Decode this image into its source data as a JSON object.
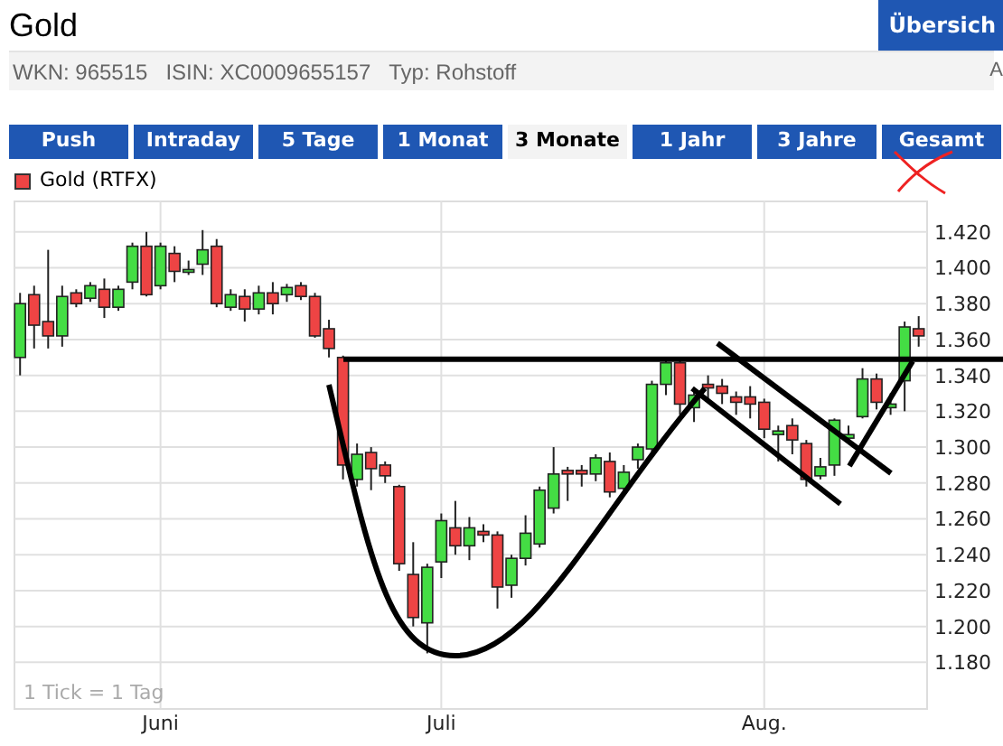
{
  "header": {
    "title": "Gold",
    "button": "Übersich"
  },
  "info_bar": {
    "items": [
      "WKN: 965515",
      "ISIN: XC0009655157",
      "Typ: Rohstoff"
    ],
    "right_text": "A"
  },
  "tabs": [
    {
      "label": "Push",
      "selected": false
    },
    {
      "label": "Intraday",
      "selected": false
    },
    {
      "label": "5 Tage",
      "selected": false
    },
    {
      "label": "1 Monat",
      "selected": false
    },
    {
      "label": "3 Monate",
      "selected": true
    },
    {
      "label": "1 Jahr",
      "selected": false
    },
    {
      "label": "3 Jahre",
      "selected": false
    },
    {
      "label": "Gesamt",
      "selected": false
    }
  ],
  "legend": {
    "label": "Gold (RTFX)"
  },
  "chart": {
    "note": "1 Tick = 1 Tag",
    "chart_data": {
      "type": "candlestick",
      "categories": [
        null,
        null,
        null,
        null,
        null,
        null,
        null,
        null,
        null,
        null,
        "Juni",
        null,
        null,
        null,
        null,
        null,
        null,
        null,
        null,
        null,
        null,
        null,
        null,
        null,
        null,
        null,
        null,
        null,
        null,
        null,
        "Juli",
        null,
        null,
        null,
        null,
        null,
        null,
        null,
        null,
        null,
        null,
        null,
        null,
        null,
        null,
        null,
        null,
        null,
        null,
        null,
        null,
        null,
        null,
        "Aug.",
        null,
        null,
        null,
        null,
        null,
        null,
        null,
        null,
        null,
        null,
        null
      ],
      "ohlc": [
        [
          1.35,
          1.386,
          1.34,
          1.38
        ],
        [
          1.385,
          1.39,
          1.355,
          1.368
        ],
        [
          1.37,
          1.41,
          1.355,
          1.362
        ],
        [
          1.362,
          1.39,
          1.356,
          1.384
        ],
        [
          1.386,
          1.388,
          1.378,
          1.38
        ],
        [
          1.383,
          1.392,
          1.381,
          1.39
        ],
        [
          1.388,
          1.394,
          1.372,
          1.378
        ],
        [
          1.378,
          1.39,
          1.376,
          1.388
        ],
        [
          1.392,
          1.414,
          1.388,
          1.412
        ],
        [
          1.412,
          1.42,
          1.384,
          1.385
        ],
        [
          1.39,
          1.414,
          1.388,
          1.412
        ],
        [
          1.408,
          1.412,
          1.392,
          1.398
        ],
        [
          1.398,
          1.404,
          1.396,
          1.399
        ],
        [
          1.402,
          1.421,
          1.396,
          1.41
        ],
        [
          1.412,
          1.416,
          1.378,
          1.38
        ],
        [
          1.378,
          1.388,
          1.376,
          1.385
        ],
        [
          1.384,
          1.388,
          1.37,
          1.377
        ],
        [
          1.377,
          1.39,
          1.374,
          1.386
        ],
        [
          1.386,
          1.392,
          1.374,
          1.38
        ],
        [
          1.385,
          1.391,
          1.381,
          1.389
        ],
        [
          1.39,
          1.392,
          1.382,
          1.384
        ],
        [
          1.384,
          1.386,
          1.361,
          1.362
        ],
        [
          1.366,
          1.371,
          1.35,
          1.355
        ],
        [
          1.35,
          1.351,
          1.282,
          1.29
        ],
        [
          1.282,
          1.302,
          1.278,
          1.296
        ],
        [
          1.297,
          1.3,
          1.276,
          1.288
        ],
        [
          1.29,
          1.292,
          1.28,
          1.284
        ],
        [
          1.278,
          1.279,
          1.231,
          1.235
        ],
        [
          1.229,
          1.247,
          1.2,
          1.205
        ],
        [
          1.202,
          1.235,
          1.185,
          1.233
        ],
        [
          1.236,
          1.263,
          1.227,
          1.259
        ],
        [
          1.255,
          1.27,
          1.24,
          1.245
        ],
        [
          1.245,
          1.261,
          1.237,
          1.255
        ],
        [
          1.253,
          1.257,
          1.247,
          1.251
        ],
        [
          1.251,
          1.253,
          1.21,
          1.222
        ],
        [
          1.223,
          1.24,
          1.216,
          1.238
        ],
        [
          1.238,
          1.262,
          1.234,
          1.252
        ],
        [
          1.246,
          1.278,
          1.244,
          1.276
        ],
        [
          1.266,
          1.3,
          1.263,
          1.285
        ],
        [
          1.287,
          1.289,
          1.27,
          1.285
        ],
        [
          1.287,
          1.29,
          1.278,
          1.285
        ],
        [
          1.285,
          1.296,
          1.281,
          1.294
        ],
        [
          1.292,
          1.297,
          1.272,
          1.275
        ],
        [
          1.277,
          1.29,
          1.274,
          1.286
        ],
        [
          1.293,
          1.302,
          1.288,
          1.3
        ],
        [
          1.299,
          1.337,
          1.297,
          1.335
        ],
        [
          1.335,
          1.349,
          1.329,
          1.347
        ],
        [
          1.347,
          1.349,
          1.318,
          1.324
        ],
        [
          1.322,
          1.331,
          1.314,
          1.329
        ],
        [
          1.335,
          1.34,
          1.326,
          1.333
        ],
        [
          1.334,
          1.338,
          1.324,
          1.33
        ],
        [
          1.328,
          1.331,
          1.318,
          1.325
        ],
        [
          1.328,
          1.334,
          1.316,
          1.324
        ],
        [
          1.325,
          1.327,
          1.305,
          1.31
        ],
        [
          1.307,
          1.312,
          1.292,
          1.309
        ],
        [
          1.312,
          1.316,
          1.296,
          1.304
        ],
        [
          1.302,
          1.304,
          1.278,
          1.282
        ],
        [
          1.284,
          1.294,
          1.282,
          1.289
        ],
        [
          1.29,
          1.316,
          1.284,
          1.315
        ],
        [
          1.305,
          1.312,
          1.302,
          1.307
        ],
        [
          1.317,
          1.344,
          1.316,
          1.338
        ],
        [
          1.338,
          1.341,
          1.321,
          1.325
        ],
        [
          1.322,
          1.33,
          1.318,
          1.324
        ],
        [
          1.337,
          1.37,
          1.32,
          1.367
        ],
        [
          1.366,
          1.373,
          1.356,
          1.362
        ]
      ],
      "grid": true,
      "ref_lines": [
        {
          "axis": "y",
          "value": 1.349
        }
      ],
      "ylim": [
        1.154,
        1.437
      ],
      "yticks": [
        {
          "value": 1.42,
          "label": "1.420"
        },
        {
          "value": 1.4,
          "label": "1.400"
        },
        {
          "value": 1.38,
          "label": "1.380"
        },
        {
          "value": 1.36,
          "label": "1.360"
        },
        {
          "value": 1.34,
          "label": "1.340"
        },
        {
          "value": 1.32,
          "label": "1.320"
        },
        {
          "value": 1.3,
          "label": "1.300"
        },
        {
          "value": 1.28,
          "label": "1.280"
        },
        {
          "value": 1.26,
          "label": "1.260"
        },
        {
          "value": 1.24,
          "label": "1.240"
        },
        {
          "value": 1.22,
          "label": "1.220"
        },
        {
          "value": 1.2,
          "label": "1.200"
        },
        {
          "value": 1.18,
          "label": "1.180"
        }
      ]
    }
  }
}
